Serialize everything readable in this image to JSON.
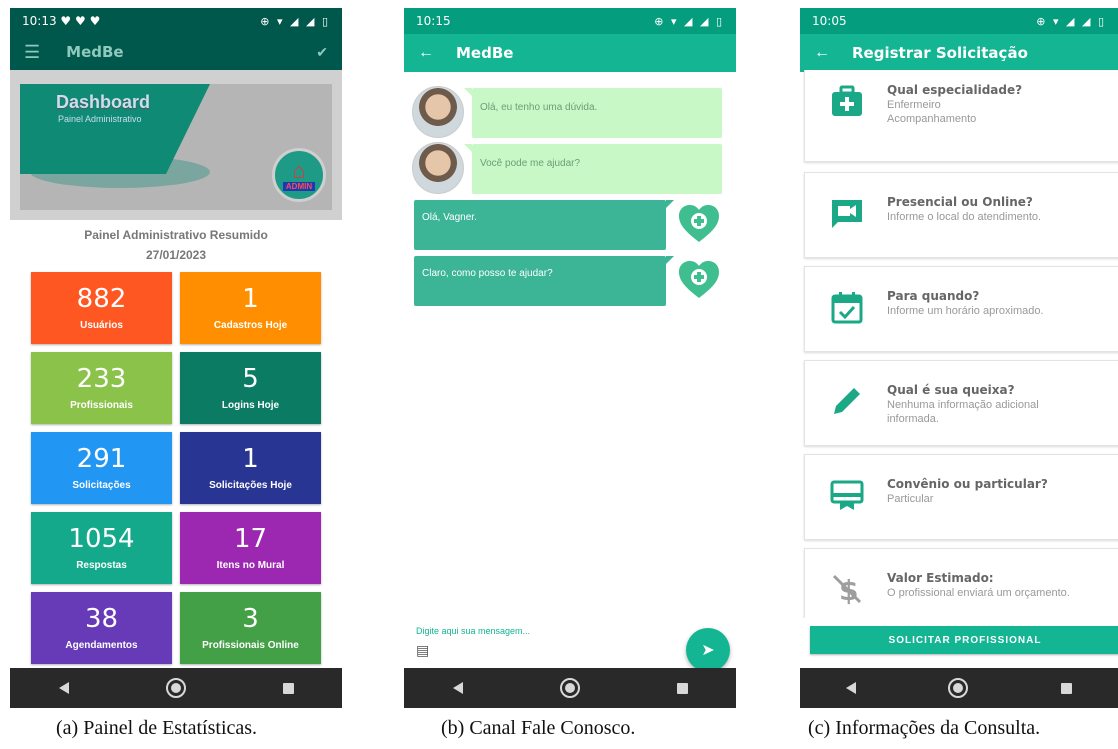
{
  "panel_a": {
    "status_time": "10:13",
    "status_left_icons": "♥ ♥ ♥",
    "status_right_icons": "⊕ ▾ ◢ ◢ ▯",
    "app_title": "MedBe",
    "banner_title": "Dashboard",
    "banner_subtitle": "Painel Administrativo",
    "admin_badge": "ADMIN",
    "summary_title": "Painel Administrativo Resumido",
    "summary_date": "27/01/2023",
    "tiles": [
      {
        "value": "882",
        "label": "Usuários",
        "color": "#ff5722"
      },
      {
        "value": "1",
        "label": "Cadastros Hoje",
        "color": "#ff8f00"
      },
      {
        "value": "233",
        "label": "Profissionais",
        "color": "#8bc34a"
      },
      {
        "value": "5",
        "label": "Logins Hoje",
        "color": "#0b7b64"
      },
      {
        "value": "291",
        "label": "Solicitações",
        "color": "#2196f3"
      },
      {
        "value": "1",
        "label": "Solicitações Hoje",
        "color": "#283593"
      },
      {
        "value": "1054",
        "label": "Respostas",
        "color": "#13a98a"
      },
      {
        "value": "17",
        "label": "Itens no Mural",
        "color": "#9c27b0"
      },
      {
        "value": "38",
        "label": "Agendamentos",
        "color": "#673ab7"
      },
      {
        "value": "3",
        "label": "Profissionais Online",
        "color": "#43a047"
      }
    ],
    "caption": "(a) Painel de Estatísticas."
  },
  "panel_b": {
    "status_time": "10:15",
    "status_right_icons": "⊕ ▾ ◢ ◢ ▯",
    "app_title": "MedBe",
    "messages_in": [
      {
        "text": "Olá, eu tenho uma dúvida."
      },
      {
        "text": "Você pode me ajudar?"
      }
    ],
    "messages_out": [
      {
        "text": "Olá, Vagner."
      },
      {
        "text": "Claro, como posso te ajudar?"
      }
    ],
    "compose_placeholder": "Digite aqui sua mensagem...",
    "caption": "(b) Canal Fale Conosco."
  },
  "panel_c": {
    "status_time": "10:05",
    "status_right_icons": "⊕ ▾ ◢ ◢ ▯",
    "app_title": "Registrar Solicitação",
    "cards": [
      {
        "title": "Qual especialidade?",
        "lines": [
          "Enfermeiro",
          "Acompanhamento"
        ],
        "icon": "medical-kit-icon"
      },
      {
        "title": "Presencial ou Online?",
        "lines": [
          "Informe o local do atendimento."
        ],
        "icon": "video-camera-icon"
      },
      {
        "title": "Para quando?",
        "lines": [
          "Informe um horário aproximado."
        ],
        "icon": "calendar-check-icon"
      },
      {
        "title": "Qual é sua queixa?",
        "lines": [
          "Nenhuma informação adicional",
          "informada."
        ],
        "icon": "pencil-icon"
      },
      {
        "title": "Convênio ou particular?",
        "lines": [
          "Particular"
        ],
        "icon": "card-icon"
      },
      {
        "title": "Valor Estimado:",
        "lines": [
          "O profissional enviará um orçamento."
        ],
        "icon": "money-off-icon"
      }
    ],
    "button_label": "SOLICITAR PROFISSIONAL",
    "caption": "(c) Informações da Consulta."
  },
  "colors": {
    "teal_primary": "#13b592",
    "teal_dark": "#049e7f",
    "green_dark": "#00574b",
    "bubble_in": "#c7f8c6",
    "bubble_out": "#3bb596",
    "heart": "#3fbf8f"
  }
}
